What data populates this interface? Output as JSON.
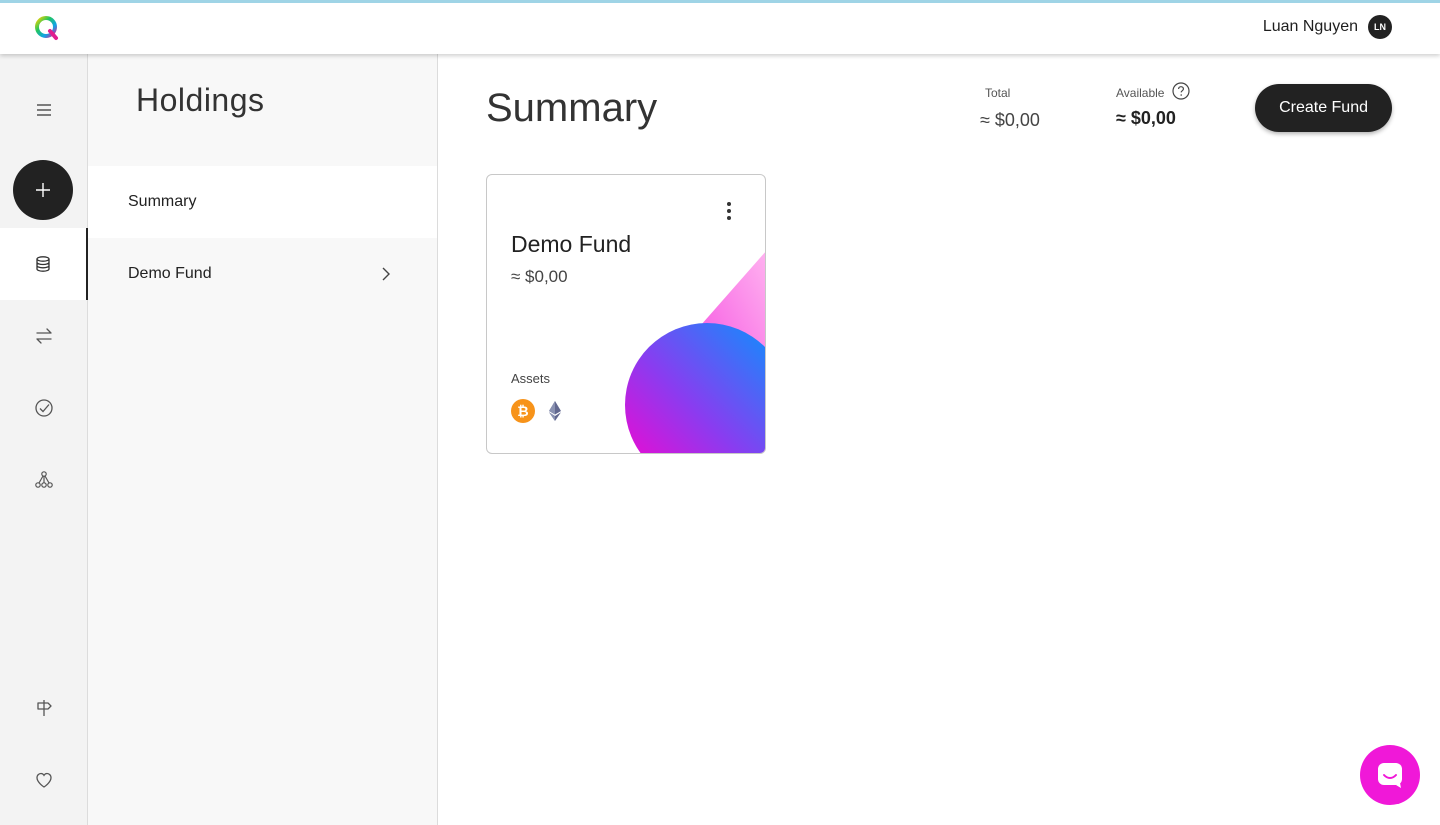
{
  "header": {
    "logo_icon": "q-logo-icon",
    "user_name": "Luan Nguyen",
    "user_initials": "LN"
  },
  "rail": {
    "items": [
      {
        "icon": "menu-icon"
      },
      {
        "icon": "plus-icon"
      },
      {
        "icon": "database-icon",
        "active": true
      },
      {
        "icon": "transfer-arrows-icon"
      },
      {
        "icon": "check-circle-icon"
      },
      {
        "icon": "network-icon"
      },
      {
        "icon": "signpost-icon"
      },
      {
        "icon": "heart-icon"
      }
    ]
  },
  "holdings": {
    "title": "Holdings",
    "items": [
      {
        "label": "Summary",
        "active": true
      },
      {
        "label": "Demo Fund",
        "has_chevron": true
      }
    ]
  },
  "main": {
    "title": "Summary",
    "total_label": "Total",
    "total_value": "≈ $0,00",
    "available_label": "Available",
    "available_value": "≈ $0,00",
    "create_button": "Create Fund"
  },
  "fund_card": {
    "title": "Demo Fund",
    "value": "≈ $0,00",
    "assets_label": "Assets",
    "assets": [
      "bitcoin-icon",
      "ethereum-icon"
    ],
    "accent_colors": [
      "#f018d8",
      "#0099ff",
      "#ff66d9"
    ]
  },
  "chat": {
    "icon": "chat-bubble-icon",
    "color": "#f018d8"
  }
}
